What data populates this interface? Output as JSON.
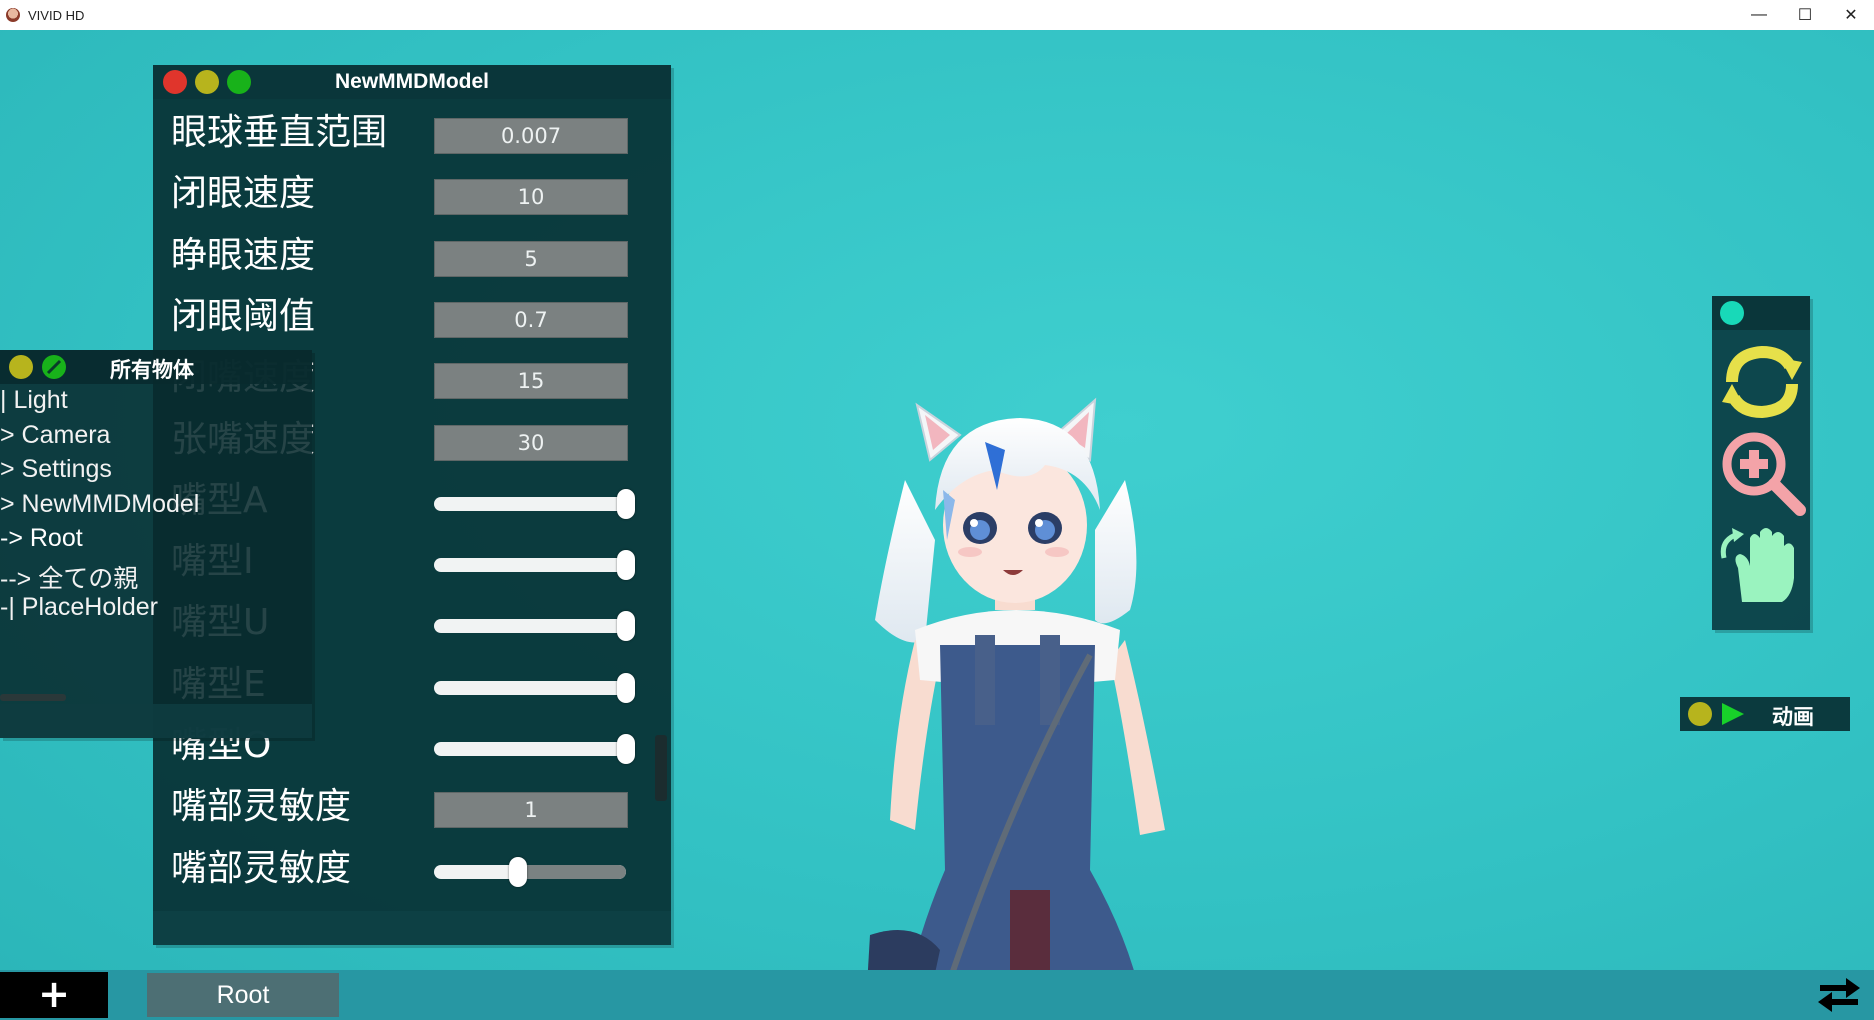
{
  "app": {
    "title": "VIVID HD"
  },
  "window_controls": {
    "minimize": "—",
    "maximize": "☐",
    "close": "✕"
  },
  "colors": {
    "background": "#35c4c6",
    "panel": "#08302f",
    "dot_red": "#e0352c",
    "dot_yellow": "#b7b41d",
    "dot_green": "#18b21a",
    "dot_teal": "#18d9b8",
    "icon_yellow": "#e6e04a",
    "icon_pink": "#f3a3a8",
    "icon_mint": "#9af3bf"
  },
  "model_panel": {
    "title": "NewMMDModel",
    "properties": [
      {
        "label": "眼球垂直范围",
        "kind": "number",
        "value": "0.007"
      },
      {
        "label": "闭眼速度",
        "kind": "number",
        "value": "10"
      },
      {
        "label": "睁眼速度",
        "kind": "number",
        "value": "5"
      },
      {
        "label": "闭眼阈值",
        "kind": "number",
        "value": "0.7"
      },
      {
        "label": "闭嘴速度",
        "kind": "number",
        "value": "15"
      },
      {
        "label": "张嘴速度",
        "kind": "number",
        "value": "30"
      },
      {
        "label": "嘴型A",
        "kind": "slider",
        "level": 1.0
      },
      {
        "label": "嘴型I",
        "kind": "slider",
        "level": 1.0
      },
      {
        "label": "嘴型U",
        "kind": "slider",
        "level": 1.0
      },
      {
        "label": "嘴型E",
        "kind": "slider",
        "level": 1.0
      },
      {
        "label": "嘴型O",
        "kind": "slider",
        "level": 1.0
      },
      {
        "label": "嘴部灵敏度",
        "kind": "number",
        "value": "1"
      },
      {
        "label": "嘴部灵敏度",
        "kind": "slider",
        "level": 0.44
      }
    ]
  },
  "objects_panel": {
    "title": "所有物体",
    "items": [
      {
        "label": "| Light"
      },
      {
        "label": " > Camera"
      },
      {
        "label": " > Settings"
      },
      {
        "label": " > NewMMDModel"
      },
      {
        "label": "-> Root",
        "selected": true
      },
      {
        "label": "--> 全ての親"
      },
      {
        "label": "-| PlaceHolder"
      }
    ]
  },
  "tools_panel": {
    "tools": [
      {
        "icon": "rotate-arrows-icon"
      },
      {
        "icon": "zoom-in-icon"
      },
      {
        "icon": "pan-hand-icon"
      }
    ]
  },
  "animation_bar": {
    "label": "动画"
  },
  "bottom_bar": {
    "add_label": "+",
    "active_tab": "Root"
  }
}
